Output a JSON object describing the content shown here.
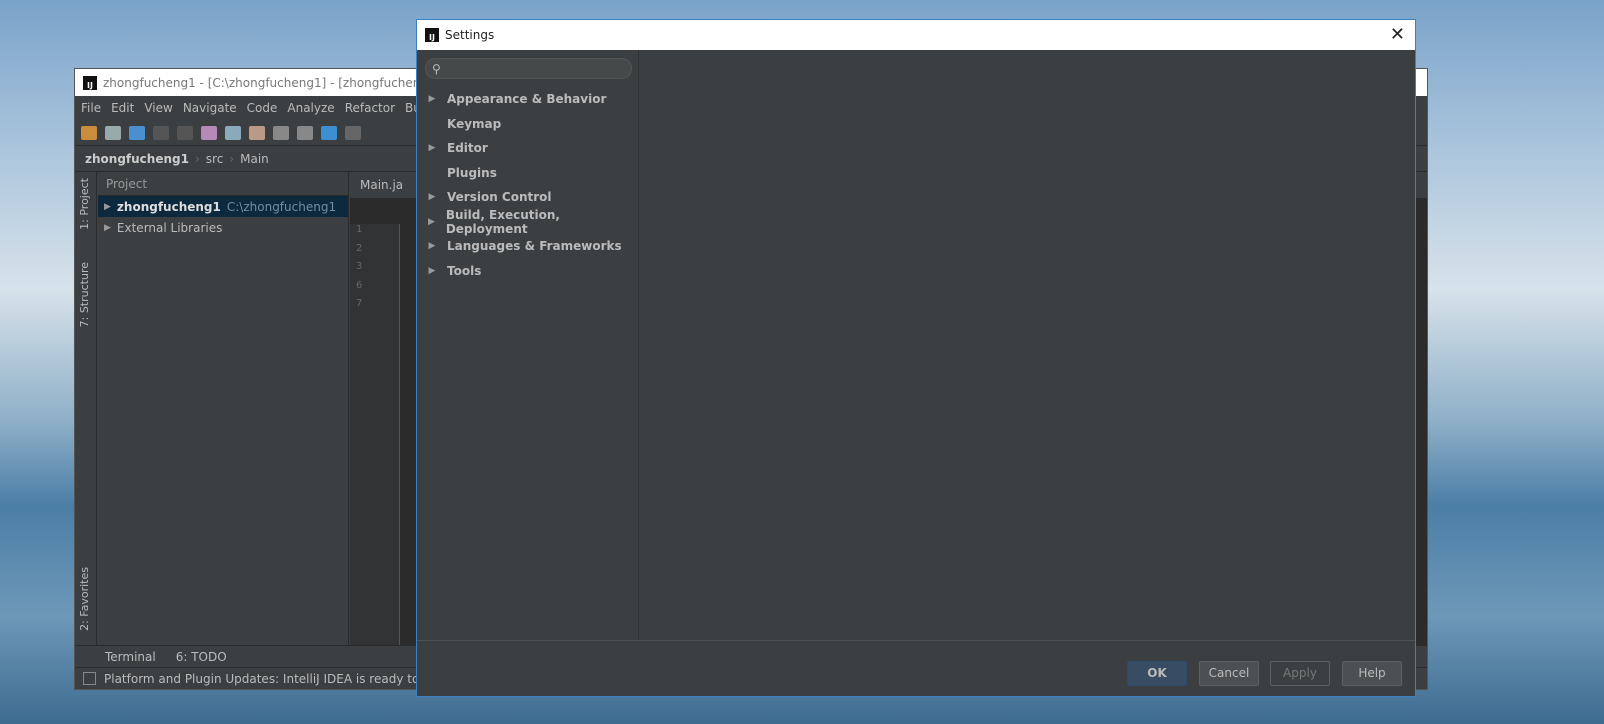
{
  "ide": {
    "title": "zhongfucheng1 - [C:\\zhongfucheng1] - [zhongfucheng1",
    "menu": [
      "File",
      "Edit",
      "View",
      "Navigate",
      "Code",
      "Analyze",
      "Refactor",
      "Bu"
    ],
    "breadcrumb": [
      "zhongfucheng1",
      "src",
      "Main"
    ],
    "project_header": "Project",
    "tree": [
      {
        "label": "zhongfucheng1",
        "path": "C:\\zhongfucheng1"
      },
      {
        "label": "External Libraries"
      }
    ],
    "side_tabs": [
      "1: Project",
      "7: Structure",
      "2: Favorites"
    ],
    "editor_tab": "Main.ja",
    "line_numbers": [
      "1",
      "2",
      "3",
      "6",
      "7"
    ],
    "bottom_tabs": [
      "Terminal",
      "6: TODO"
    ],
    "status": "Platform and Plugin Updates: IntelliJ IDEA is ready to u"
  },
  "settings": {
    "title": "Settings",
    "search_placeholder": "",
    "items": [
      {
        "label": "Appearance & Behavior",
        "expandable": true
      },
      {
        "label": "Keymap",
        "expandable": false
      },
      {
        "label": "Editor",
        "expandable": true
      },
      {
        "label": "Plugins",
        "expandable": false
      },
      {
        "label": "Version Control",
        "expandable": true
      },
      {
        "label": "Build, Execution, Deployment",
        "expandable": true
      },
      {
        "label": "Languages & Frameworks",
        "expandable": true
      },
      {
        "label": "Tools",
        "expandable": true
      }
    ],
    "buttons": {
      "ok": "OK",
      "cancel": "Cancel",
      "apply": "Apply",
      "help": "Help"
    }
  }
}
